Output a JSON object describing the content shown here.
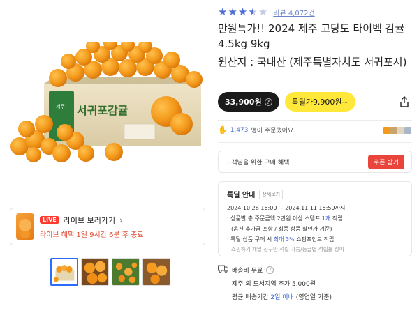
{
  "rating": {
    "stars": 3.5,
    "review_link": "리뷰 4,072건",
    "star_color": "#4f6fd3"
  },
  "product": {
    "title": "만원특가!! 2024 제주 고당도 타이벡 감귤 4.5kg 9kg",
    "origin": "원산지 : 국내산 (제주특별자치도 서귀포시)",
    "box_label": "서귀포감귤"
  },
  "price": {
    "regular": "33,900원",
    "deal": "톡딜가9,900원~",
    "info_icon": "?",
    "deal_color": "#ffe83a"
  },
  "share": {
    "icon": "share-icon"
  },
  "orders": {
    "icon": "hand-icon",
    "text": "명이 주문했어요.",
    "count": "1,473"
  },
  "coupon": {
    "label": "고객님을 위한 구매 혜택",
    "button": "쿠폰 받기",
    "button_color": "#e9453a"
  },
  "deal": {
    "title": "톡딜 안내",
    "detail": "상세보기",
    "period": "2024.10.28 16:00 ~ 2024.11.11 15:59까지",
    "line1_pre": "· 상품별 총 주문금액 2만원 이상 스탬프 ",
    "line1_hl": "1개",
    "line1_post": " 적립",
    "line1b": "(옵션 추가금 포함 / 최종 상품 할인가 기준)",
    "line2_pre": "· 톡딜 상품 구매 시 ",
    "line2_hl": "최대 3%",
    "line2_post": " 쇼핑포인트 적립",
    "note": "쇼핑하기 채널 친구만 적립 가능/등급별 적립률 상이"
  },
  "shipping": {
    "icon": "truck-icon",
    "free": "배송비 무료",
    "info_icon": "?",
    "extra": "제주 외 도서지역 추가 5,000원",
    "avg_pre": "평균 배송기간 ",
    "avg_hl": "2일 이내",
    "avg_post": " (영업일 기준)"
  },
  "live": {
    "badge": "LIVE",
    "title": "라이브 보러가기",
    "chevron": "›",
    "subtitle": "라이브 혜택 1일 9시간 6분 후 종료"
  },
  "thumbnails": {
    "count": 4,
    "active_index": 0
  }
}
